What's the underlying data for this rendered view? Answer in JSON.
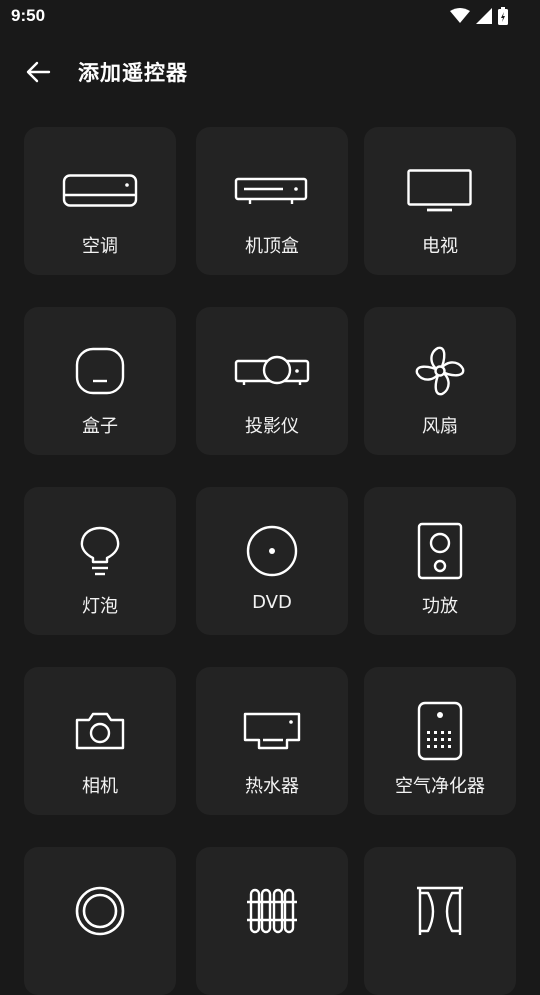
{
  "status_bar": {
    "time": "9:50"
  },
  "header": {
    "title": "添加遥控器"
  },
  "devices": [
    {
      "label": "空调",
      "icon": "air-conditioner-icon"
    },
    {
      "label": "机顶盒",
      "icon": "set-top-box-icon"
    },
    {
      "label": "电视",
      "icon": "tv-icon"
    },
    {
      "label": "盒子",
      "icon": "tv-box-icon"
    },
    {
      "label": "投影仪",
      "icon": "projector-icon"
    },
    {
      "label": "风扇",
      "icon": "fan-icon"
    },
    {
      "label": "灯泡",
      "icon": "light-bulb-icon"
    },
    {
      "label": "DVD",
      "icon": "dvd-icon"
    },
    {
      "label": "功放",
      "icon": "speaker-icon"
    },
    {
      "label": "相机",
      "icon": "camera-icon"
    },
    {
      "label": "热水器",
      "icon": "water-heater-icon"
    },
    {
      "label": "空气净化器",
      "icon": "air-purifier-icon"
    },
    {
      "label": "",
      "icon": "ring-icon"
    },
    {
      "label": "",
      "icon": "heater-icon"
    },
    {
      "label": "",
      "icon": "curtain-icon"
    }
  ]
}
